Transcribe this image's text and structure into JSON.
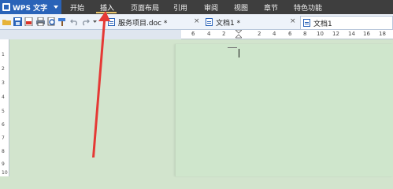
{
  "app": {
    "title": "WPS 文字"
  },
  "menu": {
    "items": [
      {
        "label": "开始"
      },
      {
        "label": "插入"
      },
      {
        "label": "页面布局"
      },
      {
        "label": "引用"
      },
      {
        "label": "审阅"
      },
      {
        "label": "视图"
      },
      {
        "label": "章节"
      },
      {
        "label": "特色功能"
      }
    ],
    "active": "插入"
  },
  "tabs": [
    {
      "label": "服务项目.doc *"
    },
    {
      "label": "文档1 *"
    },
    {
      "label": "文档1"
    }
  ],
  "ruler": {
    "h_numbers": [
      "6",
      "4",
      "2",
      "2",
      "4",
      "6",
      "8",
      "10",
      "12",
      "14",
      "16",
      "18"
    ],
    "v_numbers": [
      "1",
      "2",
      "3",
      "4",
      "5",
      "6",
      "7",
      "8",
      "9",
      "10"
    ]
  },
  "colors": {
    "menubar": "#3e3e3e",
    "app_button": "#2a63b8",
    "page_background": "#cfe6cc",
    "arrow": "#e53935"
  }
}
